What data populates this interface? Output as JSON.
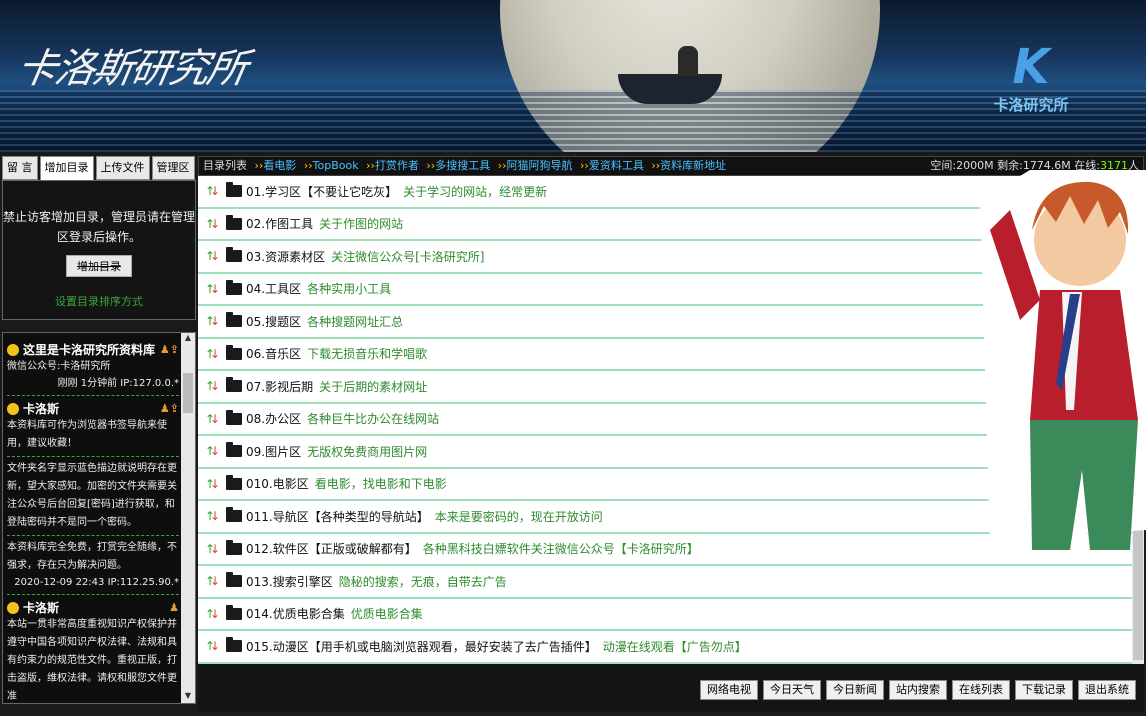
{
  "banner": {
    "signature": "卡洛斯研究所",
    "logo_letter": "K",
    "logo_text": "卡洛研究所"
  },
  "left_tabs": [
    "留 言",
    "增加目录",
    "上传文件",
    "管理区"
  ],
  "notice": {
    "message": "禁止访客增加目录，管理员请在管理区登录后操作。",
    "add_button": "增加目录",
    "sort_link": "设置目录排序方式"
  },
  "messages": [
    {
      "author": "这里是卡洛研究所资料库",
      "body": "微信公众号:卡洛研究所",
      "meta": "刚刚 1分钟前 IP:127.0.0.*"
    },
    {
      "author": "卡洛斯",
      "body": "本资料库可作为浏览器书签导航来使用，建议收藏！",
      "body2": "文件夹名字显示蓝色描边就说明存在更新，望大家感知。加密的文件夹需要关注公众号后台回复[密码]进行获取，和登陆密码并不是同一个密码。",
      "body3": "本资料库完全免费，打赏完全随缘，不强求，存在只为解决问题。",
      "meta": "2020-12-09 22:43 IP:112.25.90.*"
    },
    {
      "author": "卡洛斯",
      "body": "本站一贯非常高度重视知识产权保护并遵守中国各项知识产权法律、法规和具有约束力的规范性文件。重视正版，打击盗版，维权法律。请权和服您文件更准"
    }
  ],
  "nav": {
    "label": "目录列表",
    "links": [
      "看电影",
      "TopBook",
      "打赏作者",
      "多搜搜工具",
      "阿猫阿狗导航",
      "爱资料工具",
      "资料库新地址"
    ],
    "stats_prefix": "空间:2000M 剩余:1774.6M 在线:",
    "online": "3171",
    "stats_suffix": "人"
  },
  "folders": [
    {
      "name": "01.学习区【不要让它吃灰】",
      "desc": "关于学习的网站，经常更新"
    },
    {
      "name": "02.作图工具",
      "desc": "关于作图的网站"
    },
    {
      "name": "03.资源素材区",
      "desc": "关注微信公众号[卡洛研究所]"
    },
    {
      "name": "04.工具区",
      "desc": "各种实用小工具"
    },
    {
      "name": "05.搜题区",
      "desc": "各种搜题网址汇总"
    },
    {
      "name": "06.音乐区",
      "desc": "下载无损音乐和学唱歌"
    },
    {
      "name": "07.影视后期",
      "desc": "关于后期的素材网址"
    },
    {
      "name": "08.办公区",
      "desc": "各种巨牛比办公在线网站"
    },
    {
      "name": "09.图片区",
      "desc": "无版权免费商用图片网"
    },
    {
      "name": "010.电影区",
      "desc": "看电影，找电影和下电影"
    },
    {
      "name": "011.导航区【各种类型的导航站】",
      "desc": "本来是要密码的，现在开放访问"
    },
    {
      "name": "012.软件区【正版或破解都有】",
      "desc": "各种黑科技白嫖软件关注微信公众号【卡洛研究所】"
    },
    {
      "name": "013.搜索引擎区",
      "desc": "隐秘的搜索，无痕，自带去广告"
    },
    {
      "name": "014.优质电影合集",
      "desc": "优质电影合集"
    },
    {
      "name": "015.动漫区【用手机或电脑浏览器观看，最好安装了去广告插件】",
      "desc": "动漫在线观看【广告勿点】"
    }
  ],
  "bottom_buttons": [
    "网络电视",
    "今日天气",
    "今日新闻",
    "站内搜索",
    "在线列表",
    "下载记录",
    "退出系统"
  ],
  "colors": {
    "link": "#4ac0ff",
    "desc_green": "#2e8b2e",
    "divider": "#9fe0b8",
    "online": "#7cfc00"
  }
}
